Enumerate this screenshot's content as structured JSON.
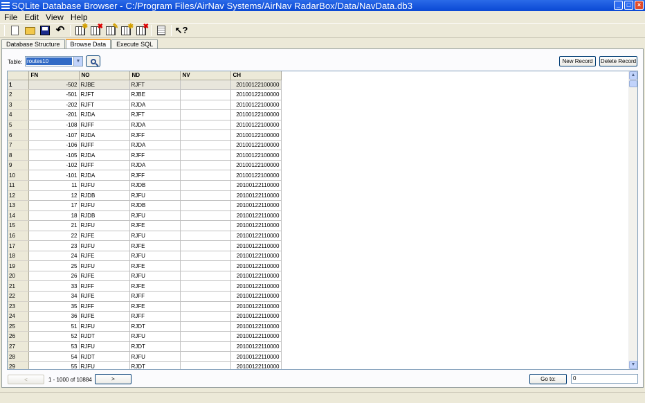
{
  "window": {
    "title": "SQLite Database Browser - C:/Program Files/AirNav Systems/AirNav RadarBox/Data/NavData.db3"
  },
  "menu": [
    "File",
    "Edit",
    "View",
    "Help"
  ],
  "tabs": [
    "Database Structure",
    "Browse Data",
    "Execute SQL"
  ],
  "browse": {
    "table_label": "Table:",
    "table_value": "routes10",
    "new_record": "New Record",
    "delete_record": "Delete Record"
  },
  "grid": {
    "columns": [
      "FN",
      "NO",
      "ND",
      "NV",
      "CH"
    ],
    "rows": [
      [
        "1",
        "-502",
        "RJBE",
        "RJFT",
        "",
        "20100122100000"
      ],
      [
        "2",
        "-501",
        "RJFT",
        "RJBE",
        "",
        "20100122100000"
      ],
      [
        "3",
        "-202",
        "RJFT",
        "RJDA",
        "",
        "20100122100000"
      ],
      [
        "4",
        "-201",
        "RJDA",
        "RJFT",
        "",
        "20100122100000"
      ],
      [
        "5",
        "-108",
        "RJFF",
        "RJDA",
        "",
        "20100122100000"
      ],
      [
        "6",
        "-107",
        "RJDA",
        "RJFF",
        "",
        "20100122100000"
      ],
      [
        "7",
        "-106",
        "RJFF",
        "RJDA",
        "",
        "20100122100000"
      ],
      [
        "8",
        "-105",
        "RJDA",
        "RJFF",
        "",
        "20100122100000"
      ],
      [
        "9",
        "-102",
        "RJFF",
        "RJDA",
        "",
        "20100122100000"
      ],
      [
        "10",
        "-101",
        "RJDA",
        "RJFF",
        "",
        "20100122100000"
      ],
      [
        "11",
        "11",
        "RJFU",
        "RJDB",
        "",
        "20100122110000"
      ],
      [
        "12",
        "12",
        "RJDB",
        "RJFU",
        "",
        "20100122110000"
      ],
      [
        "13",
        "17",
        "RJFU",
        "RJDB",
        "",
        "20100122110000"
      ],
      [
        "14",
        "18",
        "RJDB",
        "RJFU",
        "",
        "20100122110000"
      ],
      [
        "15",
        "21",
        "RJFU",
        "RJFE",
        "",
        "20100122110000"
      ],
      [
        "16",
        "22",
        "RJFE",
        "RJFU",
        "",
        "20100122110000"
      ],
      [
        "17",
        "23",
        "RJFU",
        "RJFE",
        "",
        "20100122110000"
      ],
      [
        "18",
        "24",
        "RJFE",
        "RJFU",
        "",
        "20100122110000"
      ],
      [
        "19",
        "25",
        "RJFU",
        "RJFE",
        "",
        "20100122110000"
      ],
      [
        "20",
        "26",
        "RJFE",
        "RJFU",
        "",
        "20100122110000"
      ],
      [
        "21",
        "33",
        "RJFF",
        "RJFE",
        "",
        "20100122110000"
      ],
      [
        "22",
        "34",
        "RJFE",
        "RJFF",
        "",
        "20100122110000"
      ],
      [
        "23",
        "35",
        "RJFF",
        "RJFE",
        "",
        "20100122110000"
      ],
      [
        "24",
        "36",
        "RJFE",
        "RJFF",
        "",
        "20100122110000"
      ],
      [
        "25",
        "51",
        "RJFU",
        "RJDT",
        "",
        "20100122110000"
      ],
      [
        "26",
        "52",
        "RJDT",
        "RJFU",
        "",
        "20100122110000"
      ],
      [
        "27",
        "53",
        "RJFU",
        "RJDT",
        "",
        "20100122110000"
      ],
      [
        "28",
        "54",
        "RJDT",
        "RJFU",
        "",
        "20100122110000"
      ],
      [
        "29",
        "55",
        "RJFU",
        "RJDT",
        "",
        "20100122110000"
      ]
    ]
  },
  "footer": {
    "prev": "<",
    "next": ">",
    "range": "1 - 1000 of 10884",
    "goto_label": "Go to:",
    "goto_value": "0"
  },
  "toolbar_icons": [
    "new-database-icon",
    "open-database-icon",
    "save-icon",
    "undo-icon",
    "create-table-icon",
    "delete-table-icon",
    "modify-table-icon",
    "create-index-icon",
    "delete-index-icon",
    "log-window-icon",
    "whats-this-icon"
  ]
}
